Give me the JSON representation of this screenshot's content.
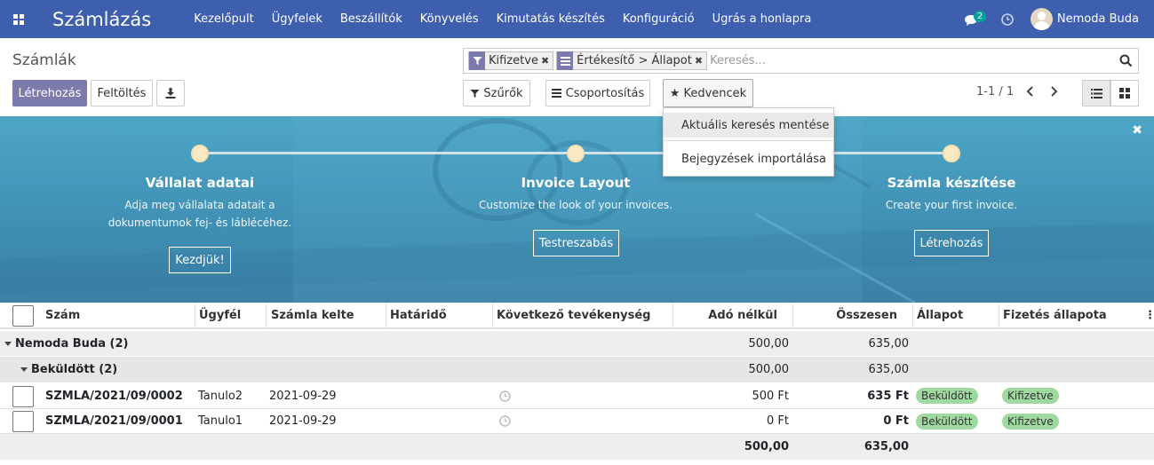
{
  "navbar": {
    "brand": "Számlázás",
    "menu": [
      "Kezelőpult",
      "Ügyfelek",
      "Beszállítók",
      "Könyvelés",
      "Kimutatás készítés",
      "Konfiguráció",
      "Ugrás a honlapra"
    ],
    "messages_count": "2",
    "user_name": "Nemoda Buda"
  },
  "control_panel": {
    "title": "Számlák",
    "create_label": "Létrehozás",
    "upload_label": "Feltöltés",
    "facets": [
      {
        "label": "Kifizetve",
        "type": "filter"
      },
      {
        "label": "Értékesítő > Állapot",
        "type": "groupby"
      }
    ],
    "search_placeholder": "Keresés...",
    "filters_label": "Szűrők",
    "groupby_label": "Csoportosítás",
    "favorites_label": "Kedvencek",
    "pager": "1-1 / 1"
  },
  "favorites_dropdown": {
    "items": [
      "Aktuális keresés mentése",
      "Bejegyzések importálása"
    ]
  },
  "onboarding": {
    "steps": [
      {
        "title": "Vállalat adatai",
        "desc_line1": "Adja meg vállalata adatait a",
        "desc_line2": "dokumentumok fej- és láblécéhez.",
        "button": "Kezdjük!"
      },
      {
        "title": "Invoice Layout",
        "desc_line1": "Customize the look of your invoices.",
        "desc_line2": "",
        "button": "Testreszabás"
      },
      {
        "title": "Számla készítése",
        "desc_line1": "Create your first invoice.",
        "desc_line2": "",
        "button": "Létrehozás"
      }
    ]
  },
  "table": {
    "columns": [
      "Szám",
      "Ügyfél",
      "Számla kelte",
      "Határidő",
      "Következő tevékenység",
      "Adó nélkül",
      "Összesen",
      "Állapot",
      "Fizetés állapota"
    ],
    "groups": [
      {
        "label": "Nemoda Buda (2)",
        "untaxed": "500,00",
        "total": "635,00"
      },
      {
        "label": "Beküldött (2)",
        "untaxed": "500,00",
        "total": "635,00"
      }
    ],
    "rows": [
      {
        "number": "SZMLA/2021/09/0002",
        "customer": "Tanulo2",
        "date": "2021-09-29",
        "due": "",
        "untaxed": "500 Ft",
        "total": "635 Ft",
        "status": "Beküldött",
        "payment": "Kifizetve"
      },
      {
        "number": "SZMLA/2021/09/0001",
        "customer": "Tanulo1",
        "date": "2021-09-29",
        "due": "",
        "untaxed": "0 Ft",
        "total": "0 Ft",
        "status": "Beküldött",
        "payment": "Kifizetve"
      }
    ],
    "footer": {
      "untaxed": "500,00",
      "total": "635,00"
    }
  },
  "colors": {
    "navbar": "#3e5eae",
    "primary": "#7c7bad",
    "badge_green": "#a0d9a0",
    "banner": "#4ea6c7"
  }
}
